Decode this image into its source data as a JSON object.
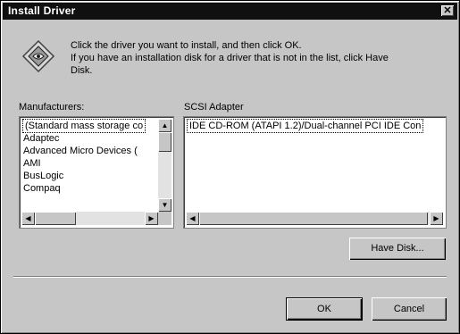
{
  "window": {
    "title": "Install Driver",
    "close_glyph": "✕"
  },
  "instructions": {
    "line1": "Click the driver you want to install, and then click OK.",
    "line2": "If you have an installation disk for a driver that is not in the list, click Have",
    "line3": "Disk."
  },
  "manufacturers": {
    "label": "Manufacturers:",
    "items": [
      "(Standard mass storage co",
      "Adaptec",
      "Advanced Micro Devices (",
      "AMI",
      "BusLogic",
      "Compaq"
    ]
  },
  "adapters": {
    "label": "SCSI Adapter",
    "items": [
      "IDE CD-ROM (ATAPI 1.2)/Dual-channel PCI IDE Con"
    ]
  },
  "buttons": {
    "have_disk": "Have Disk...",
    "ok": "OK",
    "cancel": "Cancel"
  },
  "icons": {
    "dialog": "install-driver-icon",
    "scroll_up": "▲",
    "scroll_down": "▼",
    "scroll_left": "◀",
    "scroll_right": "▶"
  }
}
